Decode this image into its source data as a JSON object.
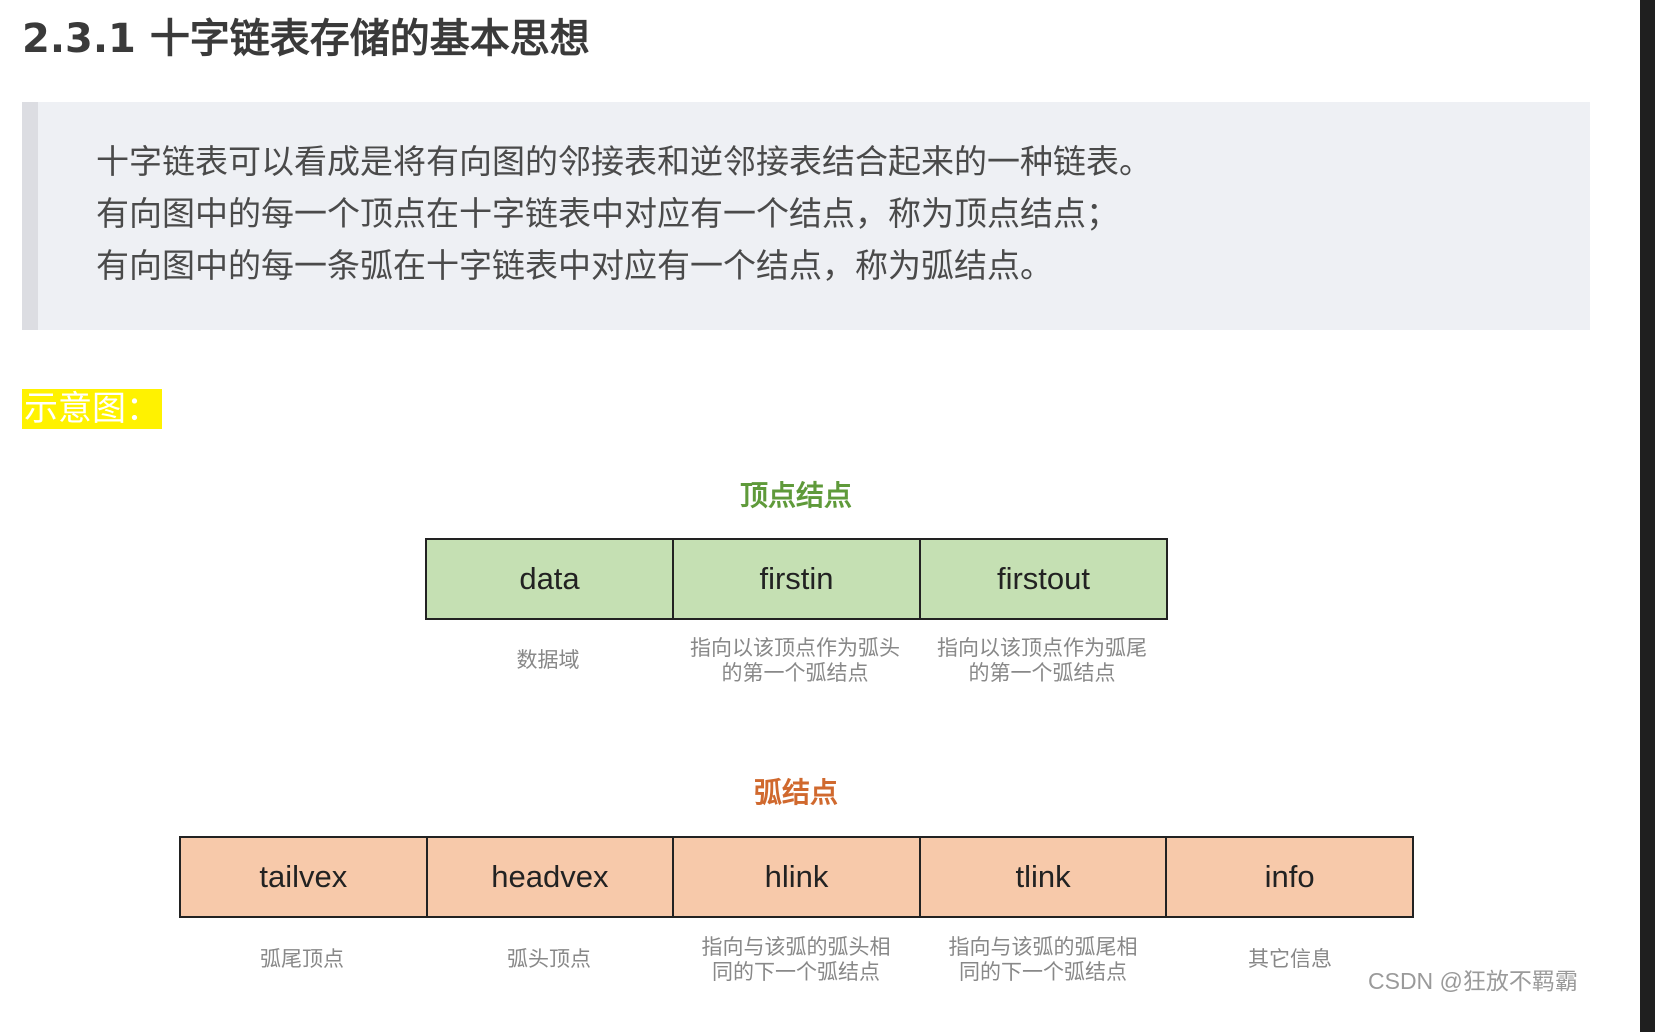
{
  "heading": "2.3.1 十字链表存储的基本思想",
  "quote": {
    "lines": [
      "十字链表可以看成是将有向图的邻接表和逆邻接表结合起来的一种链表。",
      "有向图中的每一个顶点在十字链表中对应有一个结点，称为顶点结点；",
      "有向图中的每一条弧在十字链表中对应有一个结点，称为弧结点。"
    ]
  },
  "highlight_label": "示意图：",
  "vertex_node": {
    "title": "顶点结点",
    "title_color": "#5f9a3a",
    "fill_color": "#c5e0b3",
    "fields": [
      "data",
      "firstin",
      "firstout"
    ],
    "descriptions": [
      "数据域",
      "指向以该顶点作为弧头\n的第一个弧结点",
      "指向以该顶点作为弧尾\n的第一个弧结点"
    ]
  },
  "arc_node": {
    "title": "弧结点",
    "title_color": "#d0692e",
    "fill_color": "#f7c9aa",
    "fields": [
      "tailvex",
      "headvex",
      "hlink",
      "tlink",
      "info"
    ],
    "descriptions": [
      "弧尾顶点",
      "弧头顶点",
      "指向与该弧的弧头相\n同的下一个弧结点",
      "指向与该弧的弧尾相\n同的下一个弧结点",
      "其它信息"
    ]
  },
  "watermark": "CSDN @狂放不羁霸",
  "colors": {
    "highlight": "#fff200",
    "quote_background": "#eef0f4",
    "quote_border": "#dcdde2"
  }
}
